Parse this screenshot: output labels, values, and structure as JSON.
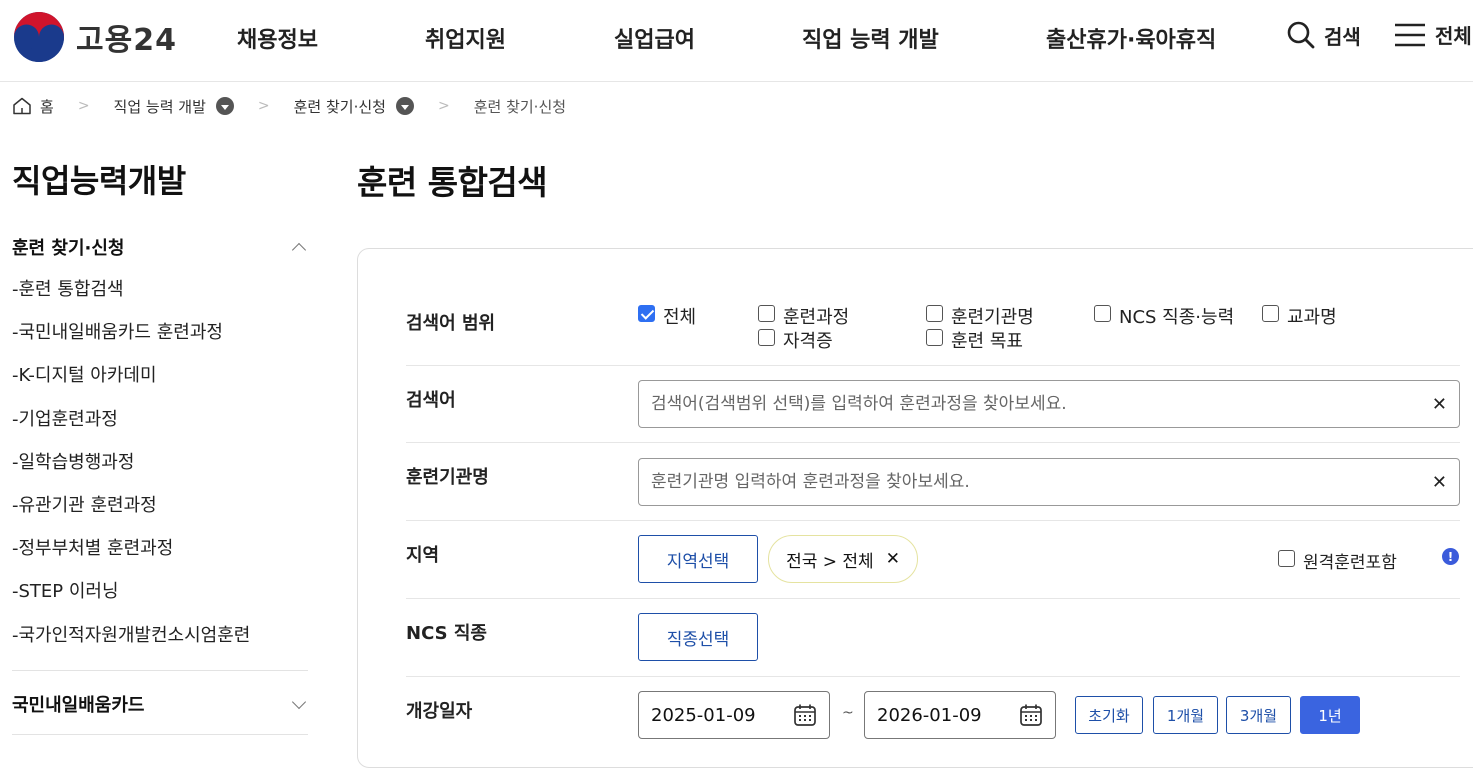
{
  "header": {
    "logo_text": "고용24",
    "nav": [
      "채용정보",
      "취업지원",
      "실업급여",
      "직업 능력 개발",
      "출산휴가·육아휴직"
    ],
    "search_label": "검색",
    "all_menu_label": "전체"
  },
  "breadcrumb": {
    "home": "홈",
    "items": [
      "직업 능력 개발",
      "훈련 찾기·신청",
      "훈련 찾기·신청"
    ]
  },
  "sidebar": {
    "title": "직업능력개발",
    "group1": "훈련 찾기·신청",
    "items": [
      "-훈련 통합검색",
      "-국민내일배움카드 훈련과정",
      "-K-디지털 아카데미",
      "-기업훈련과정",
      "-일학습병행과정",
      "-유관기관 훈련과정",
      "-정부부처별 훈련과정",
      "-STEP 이러닝",
      "-국가인적자원개발컨소시엄훈련"
    ],
    "group2": "국민내일배움카드"
  },
  "main": {
    "title": "훈련 통합검색",
    "scope": {
      "label": "검색어 범위",
      "options": [
        {
          "label": "전체",
          "checked": true
        },
        {
          "label": "훈련과정",
          "checked": false
        },
        {
          "label": "훈련기관명",
          "checked": false
        },
        {
          "label": "NCS 직종·능력",
          "checked": false
        },
        {
          "label": "교과명",
          "checked": false
        },
        {
          "label": "자격증",
          "checked": false
        },
        {
          "label": "훈련 목표",
          "checked": false
        }
      ]
    },
    "keyword": {
      "label": "검색어",
      "placeholder": "검색어(검색범위 선택)를 입력하여 훈련과정을 찾아보세요.",
      "value": ""
    },
    "institution": {
      "label": "훈련기관명",
      "placeholder": "훈련기관명 입력하여 훈련과정을 찾아보세요.",
      "value": ""
    },
    "region": {
      "label": "지역",
      "button": "지역선택",
      "chip": "전국 > 전체",
      "remote_label": "원격훈련포함",
      "remote_checked": false,
      "info": "!"
    },
    "ncs": {
      "label": "NCS 직종",
      "button": "직종선택"
    },
    "date": {
      "label": "개강일자",
      "start": "2025-01-09",
      "end": "2026-01-09",
      "separator": "~",
      "presets": [
        "초기화",
        "1개월",
        "3개월",
        "1년"
      ],
      "active_preset": "1년"
    }
  },
  "colors": {
    "primary": "#1e4fa8",
    "active": "#3a64e0",
    "checkbox": "#2e6ff2"
  }
}
